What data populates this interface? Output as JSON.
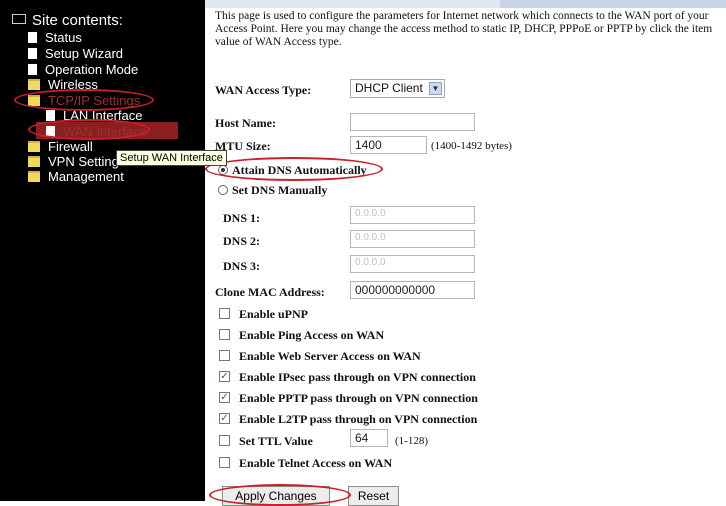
{
  "sidebar": {
    "title": "Site contents:",
    "items": [
      {
        "label": "Status",
        "icon": "page-icon"
      },
      {
        "label": "Setup Wizard",
        "icon": "page-icon"
      },
      {
        "label": "Operation Mode",
        "icon": "page-icon"
      },
      {
        "label": "Wireless",
        "icon": "folder-icon"
      },
      {
        "label": "TCP/IP Settings",
        "icon": "folder-icon"
      },
      {
        "label": "LAN Interface",
        "icon": "page-icon"
      },
      {
        "label": "WAN Interface",
        "icon": "page-icon"
      },
      {
        "label": "Firewall",
        "icon": "folder-icon"
      },
      {
        "label": "VPN Setting",
        "icon": "folder-icon"
      },
      {
        "label": "Management",
        "icon": "folder-icon"
      }
    ],
    "tooltip": "Setup WAN Interface"
  },
  "main": {
    "intro": "This page is used to configure the parameters for Internet network which connects to the WAN port of your Access Point. Here you may change the access method to static IP, DHCP, PPPoE or PPTP by click the item value of WAN Access type.",
    "wan_access_type": {
      "label": "WAN Access Type:",
      "value": "DHCP Client"
    },
    "host_name": {
      "label": "Host Name:",
      "value": ""
    },
    "mtu": {
      "label": "MTU Size:",
      "value": "1400",
      "hint": "(1400-1492 bytes)"
    },
    "dns_auto": {
      "label": "Attain DNS Automatically",
      "selected": true
    },
    "dns_manual": {
      "label": "Set DNS Manually",
      "selected": false
    },
    "dns1": {
      "label": "DNS 1:",
      "value": "0.0.0.0"
    },
    "dns2": {
      "label": "DNS 2:",
      "value": "0.0.0.0"
    },
    "dns3": {
      "label": "DNS 3:",
      "value": "0.0.0.0"
    },
    "clone_mac": {
      "label": "Clone MAC Address:",
      "value": "000000000000"
    },
    "checkboxes": [
      {
        "label": "Enable uPNP",
        "checked": false
      },
      {
        "label": "Enable Ping Access on WAN",
        "checked": false
      },
      {
        "label": "Enable Web Server Access on WAN",
        "checked": false
      },
      {
        "label": "Enable IPsec pass through on VPN connection",
        "checked": true
      },
      {
        "label": "Enable PPTP pass through on VPN connection",
        "checked": true
      },
      {
        "label": "Enable L2TP pass through on VPN connection",
        "checked": true
      }
    ],
    "ttl": {
      "label": "Set TTL Value",
      "checked": false,
      "value": "64",
      "hint": "(1-128)"
    },
    "telnet": {
      "label": "Enable Telnet Access on WAN",
      "checked": false
    },
    "apply_label": "Apply Changes",
    "reset_label": "Reset"
  },
  "colors": {
    "annotation": "#c8202b",
    "sidebar_bg": "#000000"
  }
}
